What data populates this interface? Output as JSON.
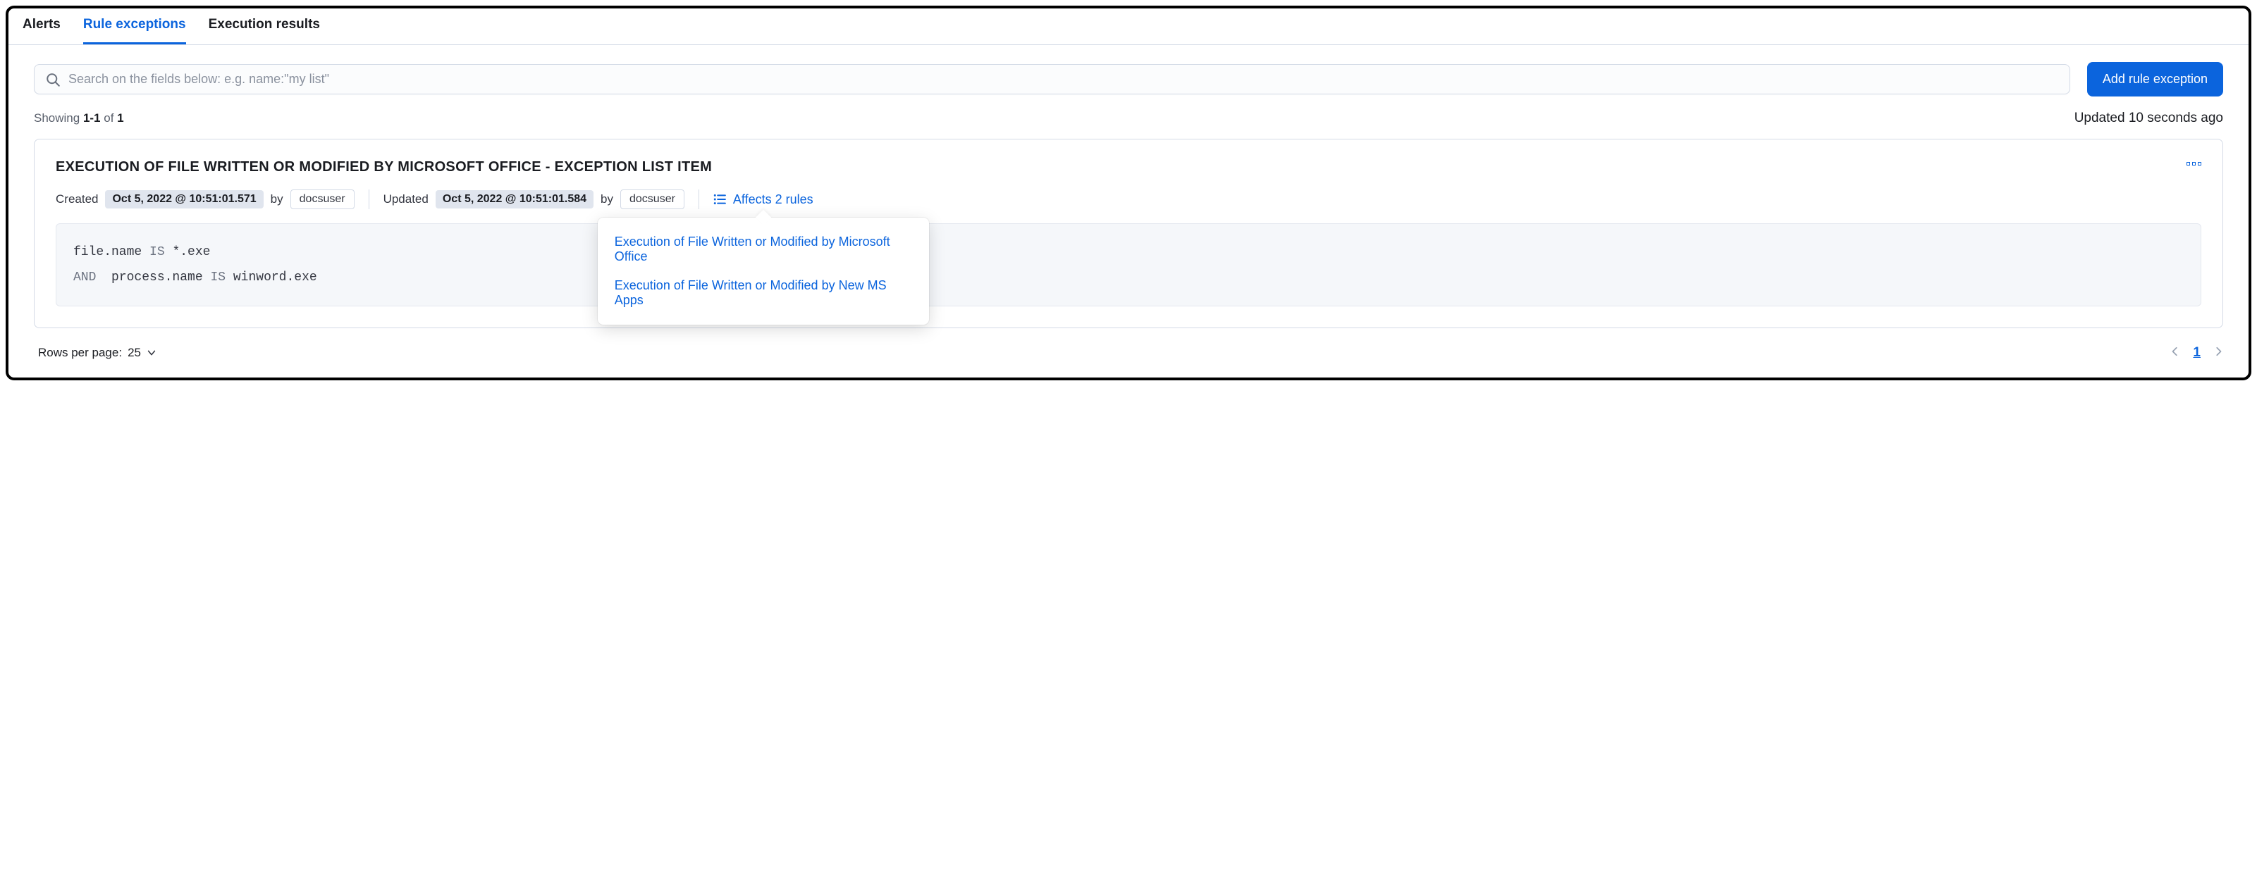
{
  "tabs": {
    "alerts": "Alerts",
    "rule_exceptions": "Rule exceptions",
    "execution_results": "Execution results"
  },
  "search": {
    "placeholder": "Search on the fields below: e.g. name:\"my list\""
  },
  "buttons": {
    "add_rule_exception": "Add rule exception"
  },
  "showing": {
    "prefix": "Showing ",
    "range": "1-1",
    "of": " of ",
    "total": "1"
  },
  "updated": {
    "label": "Updated ",
    "value": "10 seconds ago"
  },
  "card": {
    "title": "EXECUTION OF FILE WRITTEN OR MODIFIED BY MICROSOFT OFFICE - EXCEPTION LIST ITEM",
    "created_label": "Created",
    "created_date": "Oct 5, 2022 @ 10:51:01.571",
    "created_by_label": "by",
    "created_by": "docsuser",
    "updated_label": "Updated",
    "updated_date": "Oct 5, 2022 @ 10:51:01.584",
    "updated_by_label": "by",
    "updated_by": "docsuser",
    "affects_label": "Affects 2 rules",
    "popover_items": [
      "Execution of File Written or Modified by Microsoft Office",
      "Execution of File Written or Modified by New MS Apps"
    ],
    "query": {
      "line1_field": "file.name",
      "line1_op": "IS",
      "line1_value": "*.exe",
      "line2_conj": "AND",
      "line2_field": "process.name",
      "line2_op": "IS",
      "line2_value": "winword.exe"
    }
  },
  "footer": {
    "rows_label": "Rows per page: ",
    "rows_value": "25",
    "current_page": "1"
  }
}
